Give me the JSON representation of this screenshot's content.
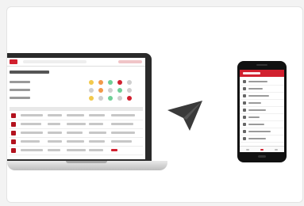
{
  "illustration": {
    "laptop_label": "",
    "phone_label": "",
    "arrow_icon": "paper-plane-send-icon"
  },
  "colors": {
    "accent": "#d1202f",
    "device_dark": "#111111",
    "arrow": "#3a3a3a"
  }
}
